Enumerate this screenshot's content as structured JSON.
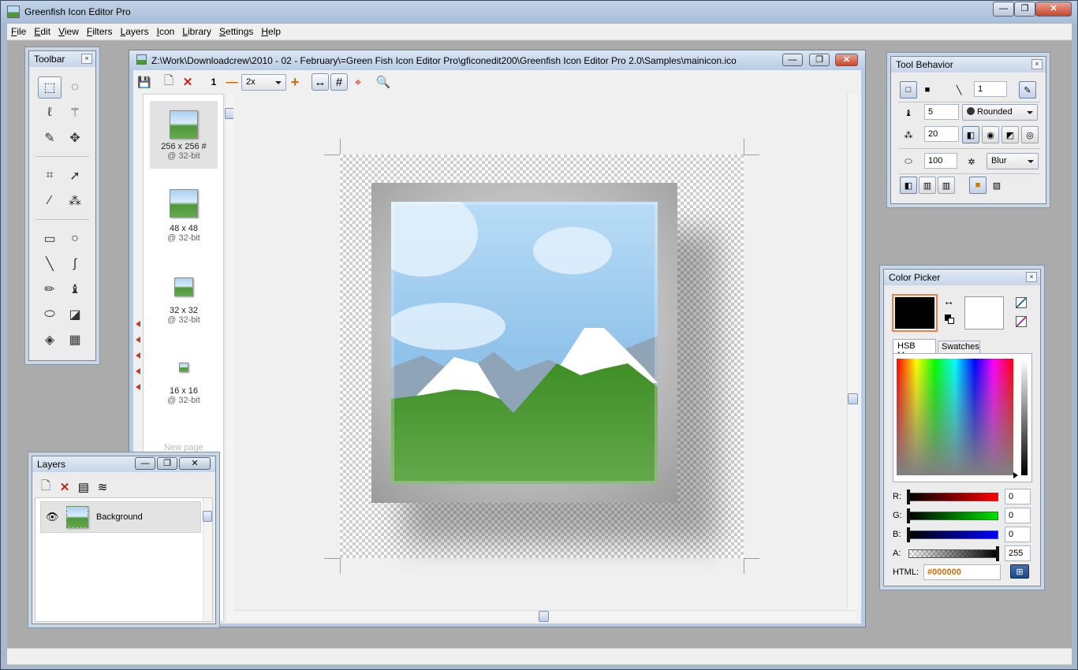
{
  "window": {
    "title": "Greenfish Icon Editor Pro",
    "controls": [
      "—",
      "❐",
      "✕"
    ]
  },
  "menu": [
    "File",
    "Edit",
    "View",
    "Filters",
    "Layers",
    "Icon",
    "Library",
    "Settings",
    "Help"
  ],
  "toolbar_panel": {
    "title": "Toolbar",
    "close": "×",
    "tools": [
      {
        "icon": "rect-select-icon",
        "glyph": "⬚"
      },
      {
        "icon": "ellipse-select-icon",
        "glyph": "◌"
      },
      {
        "icon": "lasso-icon",
        "glyph": "ℓ"
      },
      {
        "icon": "magic-wand-icon",
        "glyph": "⚚"
      },
      {
        "icon": "pencil-select-icon",
        "glyph": "✎"
      },
      {
        "icon": "move-icon",
        "glyph": "✥"
      },
      {
        "icon": "crop-icon",
        "glyph": "⌗"
      },
      {
        "icon": "pointer-icon",
        "glyph": "➚"
      },
      {
        "icon": "eyedropper-icon",
        "glyph": "⁄"
      },
      {
        "icon": "spray-icon",
        "glyph": "⁂"
      },
      {
        "icon": "rectangle-icon",
        "glyph": "▭"
      },
      {
        "icon": "ellipse-icon",
        "glyph": "○"
      },
      {
        "icon": "line-icon",
        "glyph": "╲"
      },
      {
        "icon": "curve-icon",
        "glyph": "ʃ"
      },
      {
        "icon": "pen-icon",
        "glyph": "✏"
      },
      {
        "icon": "brush-icon",
        "glyph": "♝"
      },
      {
        "icon": "eraser-icon",
        "glyph": "⬭"
      },
      {
        "icon": "color-replace-icon",
        "glyph": "◪"
      },
      {
        "icon": "fill-bucket-icon",
        "glyph": "◈"
      },
      {
        "icon": "gradient-icon",
        "glyph": "▦"
      }
    ]
  },
  "document": {
    "title": "Z:\\Work\\Downloadcrew\\2010 - 02 - February\\=Green Fish Icon Editor Pro\\gficonedit200\\Greenfish Icon Editor Pro 2.0\\Samples\\mainicon.ico",
    "controls": [
      "—",
      "❐",
      "✕"
    ],
    "toolbar": {
      "save": "💾",
      "new_page": "🗋",
      "delete_page": "✕",
      "actual_size": "1",
      "zoom_out": "—",
      "zoom": "2x",
      "zoom_in": "+",
      "fit": "↔",
      "grid": "#",
      "center_guide": "⌖",
      "zoom_tool": "🔍"
    },
    "pages": [
      {
        "size": "256 x 256 #",
        "depth": "@ 32-bit"
      },
      {
        "size": "48 x 48",
        "depth": "@ 32-bit"
      },
      {
        "size": "32 x 32",
        "depth": "@ 32-bit"
      },
      {
        "size": "16 x 16",
        "depth": "@ 32-bit"
      }
    ],
    "new_page_label": "New page"
  },
  "layers_panel": {
    "title": "Layers",
    "controls": [
      "—",
      "❐",
      "✕"
    ],
    "layers": [
      {
        "name": "Background",
        "visible_icon": "👁"
      }
    ]
  },
  "tool_behavior": {
    "title": "Tool Behavior",
    "close": "×",
    "line_width": "1",
    "brush_size": "5",
    "brush_shape": "Rounded",
    "spray_amount": "20",
    "eraser_opacity": "100",
    "effect": "Blur"
  },
  "color_picker": {
    "title": "Color Picker",
    "close": "×",
    "tabs": [
      "HSB Map",
      "Swatches"
    ],
    "primary_color": "#000000",
    "secondary_color": "#ffffff",
    "swap_icon": "↔",
    "channels": [
      {
        "label": "R:",
        "value": "0",
        "color": "#ff0000"
      },
      {
        "label": "G:",
        "value": "0",
        "color": "#00e000"
      },
      {
        "label": "B:",
        "value": "0",
        "color": "#0000ff"
      },
      {
        "label": "A:",
        "value": "255",
        "color": "#000000"
      }
    ],
    "html_label": "HTML:",
    "html_value": "#000000"
  }
}
